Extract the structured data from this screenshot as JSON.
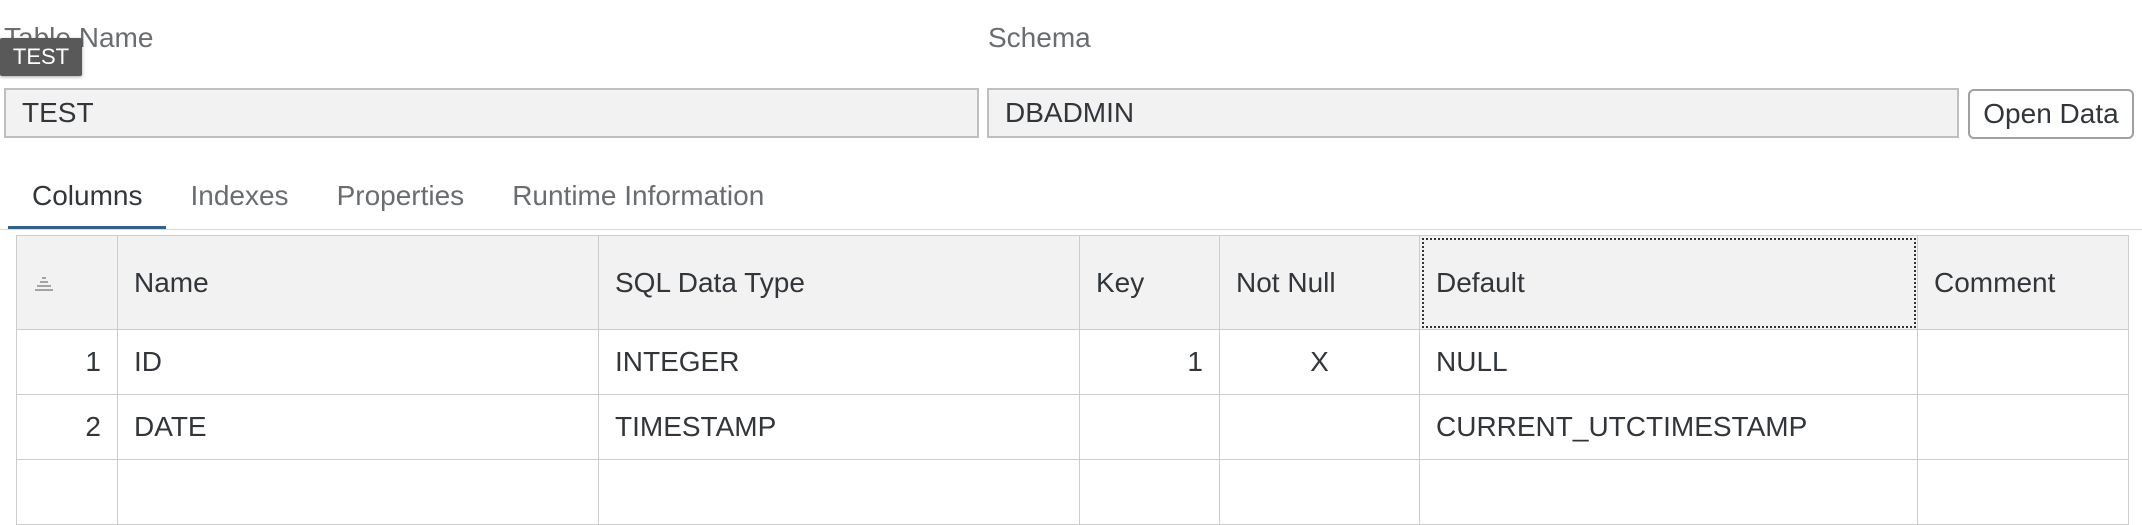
{
  "form": {
    "table_name_label": "Table Name",
    "table_name_value": "TEST",
    "schema_label": "Schema",
    "schema_value": "DBADMIN",
    "tooltip": "TEST",
    "open_data_label": "Open Data"
  },
  "tabs": [
    {
      "label": "Columns",
      "active": true
    },
    {
      "label": "Indexes",
      "active": false
    },
    {
      "label": "Properties",
      "active": false
    },
    {
      "label": "Runtime Information",
      "active": false
    }
  ],
  "grid": {
    "headers": {
      "sort_icon": "sort-icon",
      "name": "Name",
      "sql_type": "SQL Data Type",
      "key": "Key",
      "not_null": "Not Null",
      "default": "Default",
      "comment": "Comment"
    },
    "rows": [
      {
        "index": "1",
        "name": "ID",
        "sql_type": "INTEGER",
        "key": "1",
        "not_null": "X",
        "default": "NULL",
        "comment": ""
      },
      {
        "index": "2",
        "name": "DATE",
        "sql_type": "TIMESTAMP",
        "key": "",
        "not_null": "",
        "default": "CURRENT_UTCTIMESTAMP",
        "comment": ""
      },
      {
        "index": "",
        "name": "",
        "sql_type": "",
        "key": "",
        "not_null": "",
        "default": "",
        "comment": ""
      }
    ]
  },
  "colors": {
    "active_tab_underline": "#346187",
    "tooltip_bg": "#595959",
    "input_bg": "#f2f2f2",
    "header_bg": "#f2f2f2"
  }
}
